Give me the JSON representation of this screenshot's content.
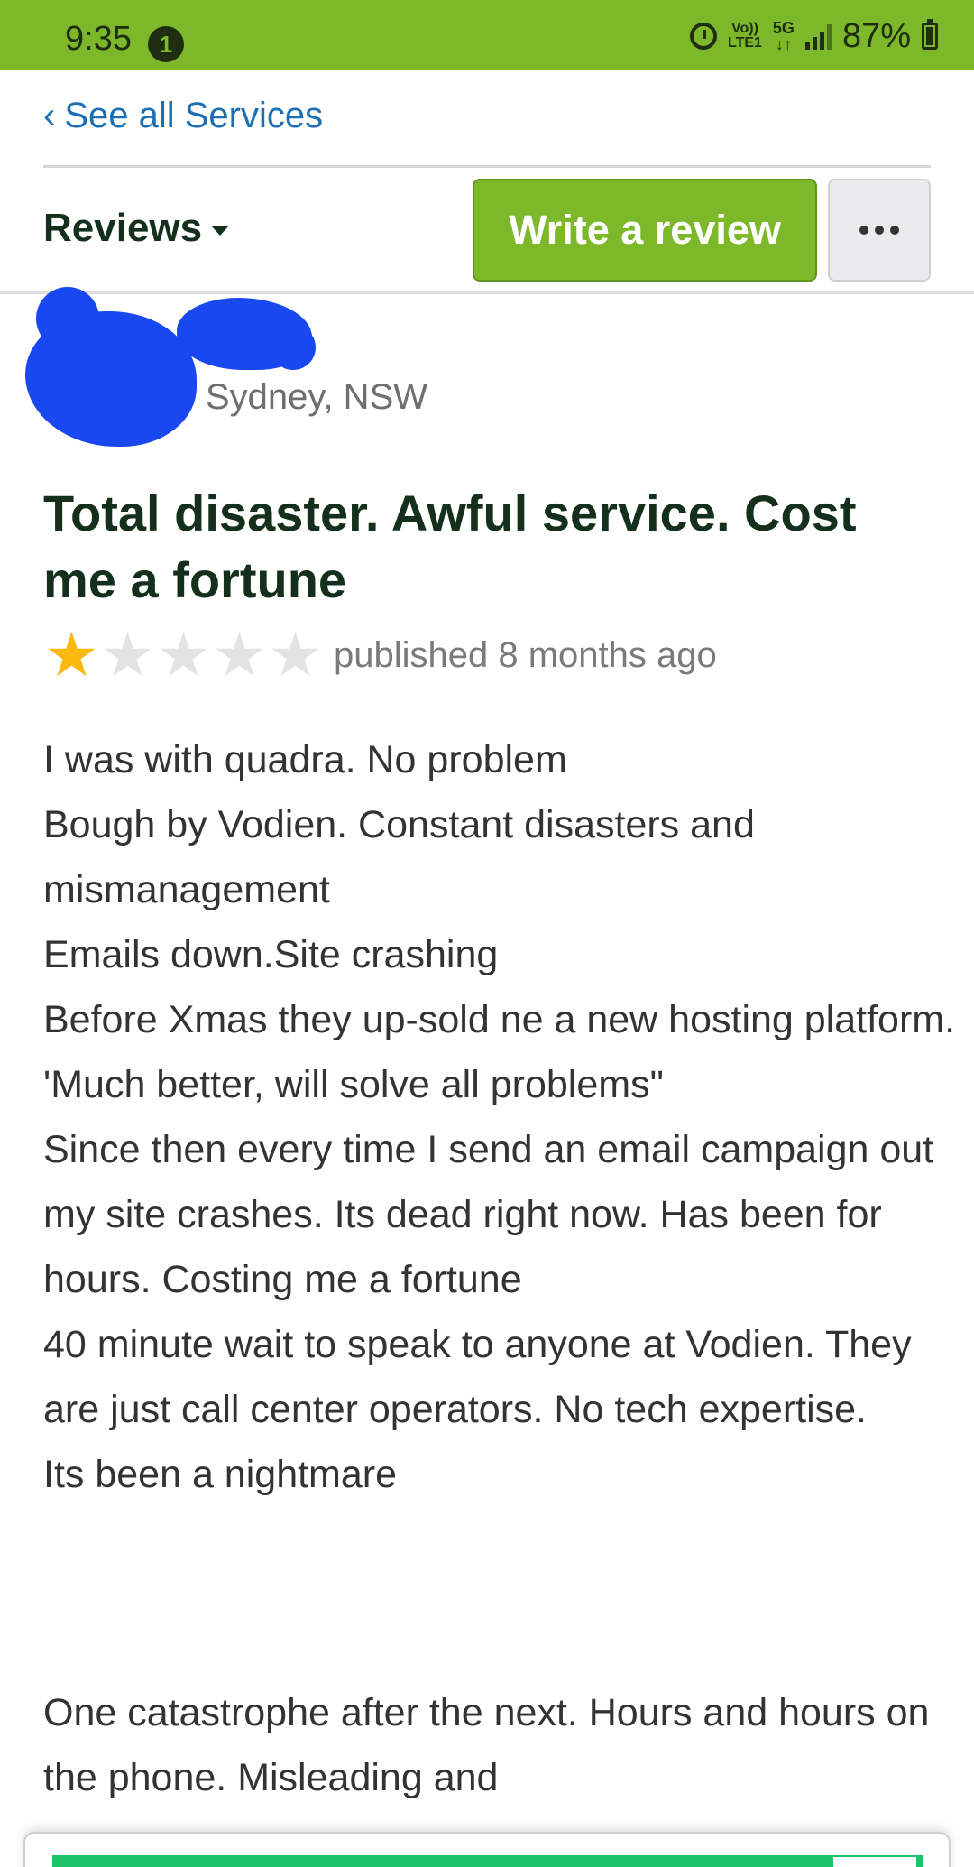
{
  "status_bar": {
    "time": "9:35",
    "notification_count": "1",
    "lte_label": "Vo)) LTE1",
    "network_label": "5G",
    "battery": "87%"
  },
  "nav": {
    "back_link": "See all Services"
  },
  "toolbar": {
    "reviews_label": "Reviews",
    "write_review_label": "Write a review"
  },
  "review": {
    "location": "Sydney, NSW",
    "title": "Total disaster. Awful service. Cost me a fortune",
    "rating": 1,
    "rating_max": 5,
    "published": "published 8 months ago",
    "body_lines": [
      "I was with quadra. No problem",
      "Bough by Vodien. Constant disasters and mismanagement",
      "Emails down.Site crashing",
      "Before Xmas they up-sold ne a new hosting platform. 'Much better, will solve all problems\"",
      "Since then every time I send an email campaign out my site crashes. Its dead right now. Has been for hours. Costing me a fortune",
      "40 minute wait to speak to anyone at Vodien. They are just call center operators. No tech expertise.",
      "Its been a nightmare"
    ],
    "paragraph2": "One catastrophe after the next. Hours and hours on the phone. Misleading and"
  },
  "colors": {
    "brand_green": "#7cb82a",
    "link_blue": "#1c6fb3",
    "star_gold": "#f9b90e",
    "redaction_blue": "#1a48f0"
  }
}
